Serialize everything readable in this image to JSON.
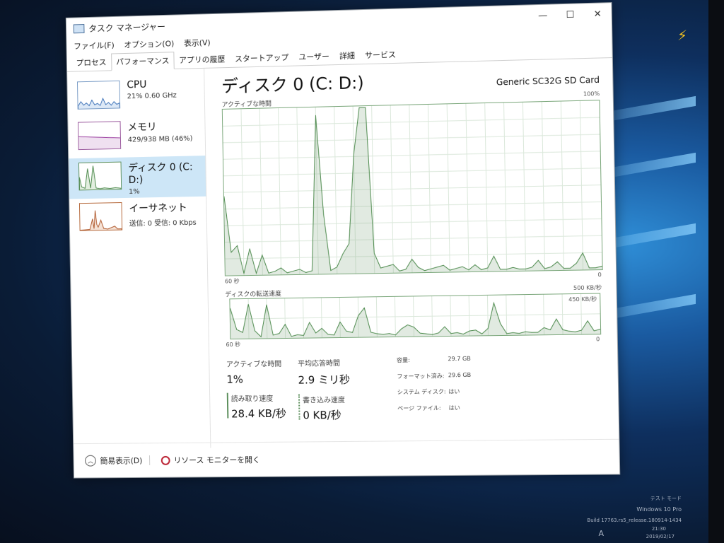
{
  "window": {
    "title": "タスク マネージャー",
    "controls": {
      "minimize": "—",
      "maximize": "☐",
      "close": "✕"
    }
  },
  "menu": [
    "ファイル(F)",
    "オプション(O)",
    "表示(V)"
  ],
  "tabs": [
    "プロセス",
    "パフォーマンス",
    "アプリの履歴",
    "スタートアップ",
    "ユーザー",
    "詳細",
    "サービス"
  ],
  "active_tab": "パフォーマンス",
  "sidebar": {
    "items": [
      {
        "title": "CPU",
        "sub": "21%  0.60 GHz"
      },
      {
        "title": "メモリ",
        "sub": "429/938 MB (46%)"
      },
      {
        "title": "ディスク 0 (C: D:)",
        "sub": "1%"
      },
      {
        "title": "イーサネット",
        "sub": "送信: 0  受信: 0 Kbps"
      }
    ]
  },
  "main": {
    "title": "ディスク 0 (C: D:)",
    "device": "Generic SC32G SD Card",
    "chart1": {
      "label": "アクティブな時間",
      "max": "100%",
      "min": "0",
      "time": "60 秒"
    },
    "chart2": {
      "label": "ディスクの転送速度",
      "left_max": "500 KB/秒",
      "right_max": "450 KB/秒",
      "min": "0",
      "time": "60 秒"
    },
    "stats": {
      "active_label": "アクティブな時間",
      "active_value": "1%",
      "resp_label": "平均応答時間",
      "resp_value": "2.9 ミリ秒",
      "read_label": "読み取り速度",
      "read_value": "28.4 KB/秒",
      "write_label": "書き込み速度",
      "write_value": "0 KB/秒"
    },
    "props": [
      {
        "k": "容量:",
        "v": "29.7 GB"
      },
      {
        "k": "フォーマット済み:",
        "v": "29.6 GB"
      },
      {
        "k": "システム ディスク:",
        "v": "はい"
      },
      {
        "k": "ページ ファイル:",
        "v": "はい"
      }
    ]
  },
  "footer": {
    "fewer": "簡易表示(D)",
    "resmon": "リソース モニターを開く"
  },
  "desktop": {
    "watermark": [
      "テスト モード",
      "Windows 10 Pro",
      "Build 17763.rs5_release.180914-1434"
    ],
    "clock_time": "21:30",
    "clock_date": "2019/02/17",
    "tray": "A"
  },
  "chart_data": [
    {
      "type": "area",
      "title": "アクティブな時間",
      "x_range": [
        60,
        0
      ],
      "ylim": [
        0,
        100
      ],
      "values": [
        48,
        14,
        18,
        1,
        16,
        1,
        12,
        1,
        2,
        4,
        1,
        2,
        3,
        1,
        2,
        96,
        36,
        2,
        4,
        12,
        18,
        72,
        100,
        100,
        12,
        3,
        4,
        5,
        1,
        2,
        8,
        3,
        1,
        2,
        3,
        4,
        1,
        2,
        3,
        1,
        4,
        1,
        2,
        9,
        1,
        1,
        2,
        1,
        1,
        2,
        6,
        1,
        2,
        5,
        1,
        1,
        4,
        10,
        1,
        1,
        2
      ]
    },
    {
      "type": "area",
      "title": "ディスクの転送速度",
      "x_range": [
        60,
        0
      ],
      "ylim": [
        0,
        500
      ],
      "values": [
        400,
        120,
        80,
        450,
        100,
        20,
        440,
        40,
        60,
        180,
        20,
        40,
        30,
        200,
        60,
        120,
        40,
        30,
        200,
        80,
        60,
        280,
        380,
        60,
        40,
        30,
        40,
        20,
        100,
        150,
        120,
        40,
        30,
        20,
        40,
        120,
        30,
        40,
        20,
        60,
        70,
        20,
        90,
        420,
        150,
        20,
        30,
        20,
        40,
        30,
        30,
        90,
        60,
        200,
        60,
        40,
        30,
        50,
        170,
        40,
        60
      ]
    }
  ]
}
